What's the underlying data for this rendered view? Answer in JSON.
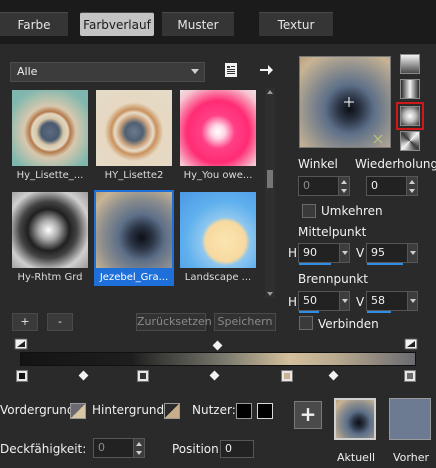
{
  "tabs": [
    {
      "label": "Farbe"
    },
    {
      "label": "Farbverlauf"
    },
    {
      "label": "Muster"
    },
    {
      "label": "Textur"
    }
  ],
  "category_select": {
    "value": "Alle"
  },
  "icons": {
    "document": "document-list-icon",
    "export": "arrow-right-icon"
  },
  "gradients": [
    {
      "label": "Hy_Lisette_..."
    },
    {
      "label": "HY_Lisette2"
    },
    {
      "label": "Hy_You owe..."
    },
    {
      "label": "Hy-Rhtm Grd"
    },
    {
      "label": "Jezebel_Gra..."
    },
    {
      "label": "Landscape ..."
    }
  ],
  "list_buttons": {
    "add": "+",
    "remove": "-",
    "reset": "Zurücksetzen",
    "save": "Speichern"
  },
  "angle": {
    "label": "Winkel",
    "value": "0"
  },
  "repeat": {
    "label": "Wiederholung",
    "value": "0"
  },
  "invert": {
    "label": "Umkehren"
  },
  "center": {
    "label": "Mittelpunkt",
    "h_label": "H",
    "h_value": "90",
    "v_label": "V",
    "v_value": "95"
  },
  "focal": {
    "label": "Brennpunkt",
    "h_label": "H",
    "h_value": "50",
    "v_label": "V",
    "v_value": "58"
  },
  "link": {
    "label": "Verbinden"
  },
  "bottom": {
    "foreground": "Vordergrund:",
    "background": "Hintergrund:",
    "user": "Nutzer:",
    "opacity": "Deckfähigkeit:",
    "opacity_value": "0",
    "position": "Position:",
    "position_value": "0",
    "add": "+",
    "current": "Aktuell",
    "previous": "Vorher"
  },
  "colors": {
    "selection_blue": "#1e6fd9",
    "highlight_red": "#d01818",
    "user_black": "#000000",
    "previous_swatch": "#6c7a92"
  }
}
